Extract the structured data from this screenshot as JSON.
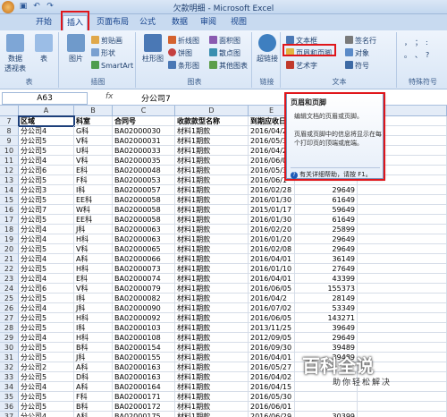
{
  "window": {
    "title": "欠款明细 - Microsoft Excel"
  },
  "tabs": [
    "开始",
    "插入",
    "页面布局",
    "公式",
    "数据",
    "审阅",
    "视图"
  ],
  "active_tab": "插入",
  "ribbon": {
    "pivot_label": "数据\n透视表",
    "table_label": "表",
    "picture_label": "图片",
    "clipart_label": "剪贴画",
    "shapes_label": "形状",
    "smartart_label": "SmartArt",
    "column_label": "柱形图",
    "line_label": "折线图",
    "pie_label": "饼图",
    "bar_label": "条形图",
    "area_label": "面积图",
    "scatter_label": "散点图",
    "other_label": "其他图表",
    "hyperlink_label": "超链接",
    "textbox_label": "文本框",
    "header_footer_label": "页眉和页脚",
    "wordart_label": "艺术字",
    "signature_label": "签名行",
    "object_label": "对象",
    "symbol_label": "符号",
    "groups": {
      "tables": "表",
      "illustrations": "插图",
      "charts": "图表",
      "links": "链接",
      "text": "文本",
      "special": "特殊符号"
    }
  },
  "formula_bar": {
    "name_box": "A63",
    "fx": "fx",
    "value": "分公司7"
  },
  "columns": [
    "A",
    "B",
    "C",
    "D",
    "E"
  ],
  "column_headers": [
    "区域",
    "科室",
    "合同号",
    "收款款型名称",
    "到期应收日"
  ],
  "rows": [
    {
      "n": "7",
      "a": "区域",
      "b": "科室",
      "c": "合同号",
      "d": "收款款型名称",
      "e": "到期应收日",
      "f": ""
    },
    {
      "n": "8",
      "a": "分公司4",
      "b": "G科",
      "c": "BA02000030",
      "d": "材料1期款",
      "e": "2016/04/2",
      "f": ""
    },
    {
      "n": "9",
      "a": "分公司5",
      "b": "V科",
      "c": "BA02000031",
      "d": "材料1期款",
      "e": "2016/05/3",
      "f": ""
    },
    {
      "n": "10",
      "a": "分公司5",
      "b": "U科",
      "c": "BA02000033",
      "d": "材料1期款",
      "e": "2016/04/2",
      "f": ""
    },
    {
      "n": "11",
      "a": "分公司4",
      "b": "V科",
      "c": "BA02000035",
      "d": "材料1期款",
      "e": "2016/06/0",
      "f": ""
    },
    {
      "n": "12",
      "a": "分公司6",
      "b": "E科",
      "c": "BA02000048",
      "d": "材料1期款",
      "e": "2016/05/3",
      "f": ""
    },
    {
      "n": "13",
      "a": "分公司5",
      "b": "F科",
      "c": "BA02000053",
      "d": "材料1期款",
      "e": "2016/06/1",
      "f": ""
    },
    {
      "n": "14",
      "a": "分公司3",
      "b": "I科",
      "c": "BA02000057",
      "d": "材料1期款",
      "e": "2016/02/28",
      "f": "29649"
    },
    {
      "n": "15",
      "a": "分公司5",
      "b": "EE科",
      "c": "BA02000058",
      "d": "材料1期款",
      "e": "2016/01/30",
      "f": "61649"
    },
    {
      "n": "16",
      "a": "分公司7",
      "b": "W科",
      "c": "BA02000058",
      "d": "材料1期款",
      "e": "2015/01/17",
      "f": "59649"
    },
    {
      "n": "17",
      "a": "分公司5",
      "b": "EE科",
      "c": "BA02000058",
      "d": "材料1期款",
      "e": "2016/01/30",
      "f": "61649"
    },
    {
      "n": "18",
      "a": "分公司4",
      "b": "J科",
      "c": "BA02000063",
      "d": "材料1期款",
      "e": "2016/02/20",
      "f": "25899"
    },
    {
      "n": "19",
      "a": "分公司4",
      "b": "H科",
      "c": "BA02000063",
      "d": "材料1期款",
      "e": "2016/01/20",
      "f": "29649"
    },
    {
      "n": "20",
      "a": "分公司5",
      "b": "V科",
      "c": "BA02000065",
      "d": "材料1期款",
      "e": "2016/02/08",
      "f": "29649"
    },
    {
      "n": "21",
      "a": "分公司4",
      "b": "A科",
      "c": "BA02000066",
      "d": "材料1期款",
      "e": "2016/04/01",
      "f": "36149"
    },
    {
      "n": "22",
      "a": "分公司5",
      "b": "H科",
      "c": "BA02000073",
      "d": "材料1期款",
      "e": "2016/01/10",
      "f": "27649"
    },
    {
      "n": "23",
      "a": "分公司4",
      "b": "E科",
      "c": "BA02000074",
      "d": "材料1期款",
      "e": "2016/04/01",
      "f": "43399"
    },
    {
      "n": "24",
      "a": "分公司6",
      "b": "V科",
      "c": "BA02000079",
      "d": "材料1期款",
      "e": "2016/06/05",
      "f": "155373"
    },
    {
      "n": "25",
      "a": "分公司5",
      "b": "I科",
      "c": "BA02000082",
      "d": "材料1期款",
      "e": "2016/04/2",
      "f": "28149"
    },
    {
      "n": "26",
      "a": "分公司4",
      "b": "J科",
      "c": "BA02000090",
      "d": "材料1期款",
      "e": "2016/07/02",
      "f": "53349"
    },
    {
      "n": "27",
      "a": "分公司5",
      "b": "H科",
      "c": "BA02000092",
      "d": "材料1期款",
      "e": "2016/06/05",
      "f": "143271"
    },
    {
      "n": "28",
      "a": "分公司5",
      "b": "I科",
      "c": "BA02000103",
      "d": "材料1期款",
      "e": "2013/11/25",
      "f": "39649"
    },
    {
      "n": "29",
      "a": "分公司4",
      "b": "H科",
      "c": "BA02000108",
      "d": "材料1期款",
      "e": "2012/09/05",
      "f": "29649"
    },
    {
      "n": "30",
      "a": "分公司5",
      "b": "B科",
      "c": "BA02000154",
      "d": "材料1期款",
      "e": "2016/09/30",
      "f": "39489"
    },
    {
      "n": "31",
      "a": "分公司5",
      "b": "J科",
      "c": "BA02000155",
      "d": "材料1期款",
      "e": "2016/04/01",
      "f": "39489"
    },
    {
      "n": "32",
      "a": "分公司2",
      "b": "A科",
      "c": "BA02000163",
      "d": "材料1期款",
      "e": "2016/05/27",
      "f": ""
    },
    {
      "n": "33",
      "a": "分公司5",
      "b": "D科",
      "c": "BA02000163",
      "d": "材料1期款",
      "e": "2016/04/02",
      "f": ""
    },
    {
      "n": "34",
      "a": "分公司4",
      "b": "A科",
      "c": "BA02000164",
      "d": "材料1期款",
      "e": "2016/04/15",
      "f": ""
    },
    {
      "n": "35",
      "a": "分公司5",
      "b": "F科",
      "c": "BA02000171",
      "d": "材料1期款",
      "e": "2016/05/30",
      "f": ""
    },
    {
      "n": "36",
      "a": "分公司5",
      "b": "B科",
      "c": "BA02000172",
      "d": "材料1期款",
      "e": "2016/06/01",
      "f": ""
    },
    {
      "n": "37",
      "a": "分公司4",
      "b": "A科",
      "c": "BA02000175",
      "d": "材料1期款",
      "e": "2016/06/29",
      "f": "30399"
    },
    {
      "n": "38",
      "a": "分公司4",
      "b": "AA科",
      "c": "BA02000178",
      "d": "材料1期款",
      "e": "2016/03/31",
      "f": "30399"
    }
  ],
  "tooltip": {
    "title": "页眉和页脚",
    "line1": "编辑文档的页眉或页脚。",
    "line2": "页眉或页脚中的信息将显示在每个打印页的顶端或底端。",
    "help": "有关详细帮助，请按 F1。"
  },
  "watermark": {
    "title": "百科全说",
    "subtitle": "助你轻松解决"
  },
  "colors": {
    "accent": "#e0161b",
    "ribbon": "#dbe7f6",
    "header": "#e4ecf7"
  }
}
